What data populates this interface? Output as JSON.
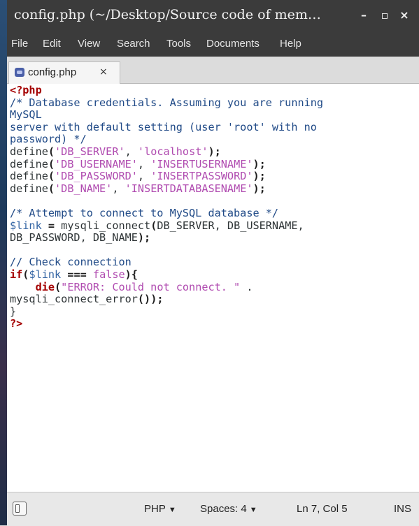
{
  "window": {
    "title": "config.php (~/Desktop/Source code of mem…",
    "minimize_label": "–",
    "maximize_label": "▫",
    "close_label": "×"
  },
  "menu": {
    "items": [
      "File",
      "Edit",
      "View",
      "Search",
      "Tools",
      "Documents",
      "Help"
    ]
  },
  "tab": {
    "label": "config.php",
    "close_label": "×"
  },
  "editor": {
    "lines": [
      "<?php",
      "/* Database credentials. Assuming you are running",
      "MySQL",
      "server with default setting (user 'root' with no",
      "password) */",
      "define('DB_SERVER', 'localhost');",
      "define('DB_USERNAME', 'INSERTUSERNAME');",
      "define('DB_PASSWORD', 'INSERTPASSWORD');",
      "define('DB_NAME', 'INSERTDATABASENAME');",
      "",
      "/* Attempt to connect to MySQL database */",
      "$link = mysqli_connect(DB_SERVER, DB_USERNAME,",
      "DB_PASSWORD, DB_NAME);",
      "",
      "// Check connection",
      "if($link === false){",
      "    die(\"ERROR: Could not connect. \" .",
      "mysqli_connect_error());",
      "}",
      "?>"
    ]
  },
  "status": {
    "language": "PHP",
    "indent": "Spaces: 4",
    "position": "Ln 7, Col 5",
    "mode": "INS"
  }
}
